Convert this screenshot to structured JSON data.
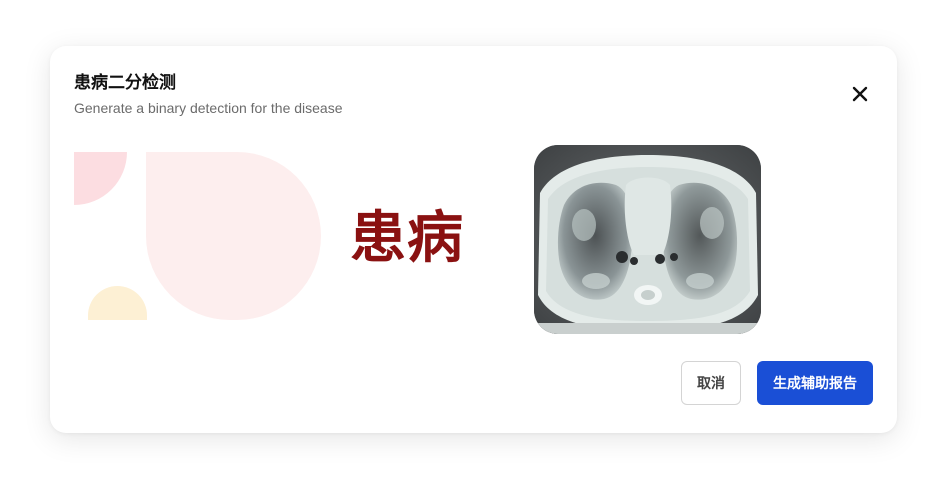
{
  "dialog": {
    "title": "患病二分检测",
    "subtitle": "Generate a binary detection for the disease"
  },
  "illustration": {
    "label": "患病",
    "label_color": "#8a1111",
    "accent_colors": [
      "#fcdde1",
      "#fdeeee",
      "#fdf0d4"
    ]
  },
  "ct_image": {
    "icon": "lung-ct-scan-image"
  },
  "actions": {
    "cancel_label": "取消",
    "generate_label": "生成辅助报告",
    "primary_color": "#1a4fd6"
  },
  "close": {
    "icon": "close-icon"
  }
}
